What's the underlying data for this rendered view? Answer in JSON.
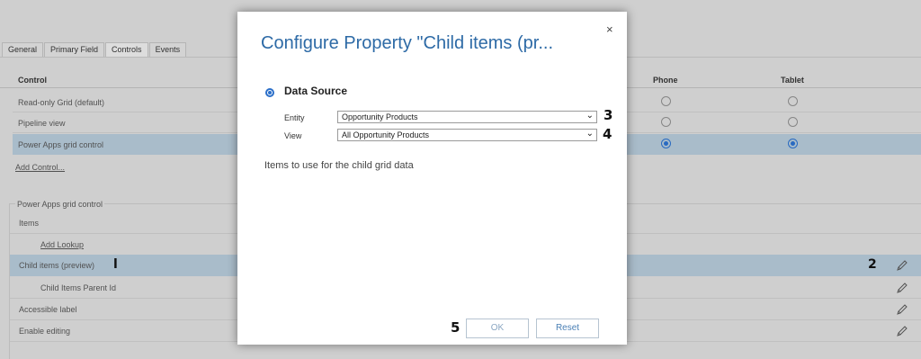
{
  "tabs": [
    "General",
    "Primary Field",
    "Controls",
    "Events"
  ],
  "controls_table": {
    "headers": {
      "control": "Control",
      "phone": "Phone",
      "tablet": "Tablet"
    },
    "rows": [
      {
        "label": "Read-only Grid (default)",
        "phone": false,
        "tablet": false,
        "selected": false
      },
      {
        "label": "Pipeline view",
        "phone": false,
        "tablet": false,
        "selected": false
      },
      {
        "label": "Power Apps grid control",
        "phone": true,
        "tablet": true,
        "selected": true
      }
    ],
    "add_control": "Add Control..."
  },
  "properties": {
    "section_title": "Power Apps grid control",
    "rows": [
      {
        "label": "Items",
        "indent": false,
        "link": false,
        "edit": false,
        "selected": false
      },
      {
        "label": "Add Lookup",
        "indent": true,
        "link": true,
        "edit": false,
        "selected": false
      },
      {
        "label": "Child items (preview)",
        "indent": false,
        "link": false,
        "edit": true,
        "selected": true
      },
      {
        "label": "Child Items Parent Id",
        "indent": true,
        "link": false,
        "edit": true,
        "selected": false
      },
      {
        "label": "Accessible label",
        "indent": false,
        "link": false,
        "edit": true,
        "selected": false
      },
      {
        "label": "Enable editing",
        "indent": false,
        "link": false,
        "edit": true,
        "selected": false
      }
    ]
  },
  "annotations": {
    "m1": "l",
    "m2": "2",
    "m3": "3",
    "m4": "4",
    "m5": "5"
  },
  "dialog": {
    "title": "Configure Property \"Child items (pr...",
    "close": "×",
    "data_source_label": "Data Source",
    "entity_label": "Entity",
    "entity_value": "Opportunity Products",
    "view_label": "View",
    "view_value": "All Opportunity Products",
    "description": "Items to use for the child grid data",
    "ok_label": "OK",
    "reset_label": "Reset"
  },
  "colors": {
    "accent": "#2b6fc9",
    "title": "#2d6aa6",
    "selected_row": "#b0c4d3"
  }
}
